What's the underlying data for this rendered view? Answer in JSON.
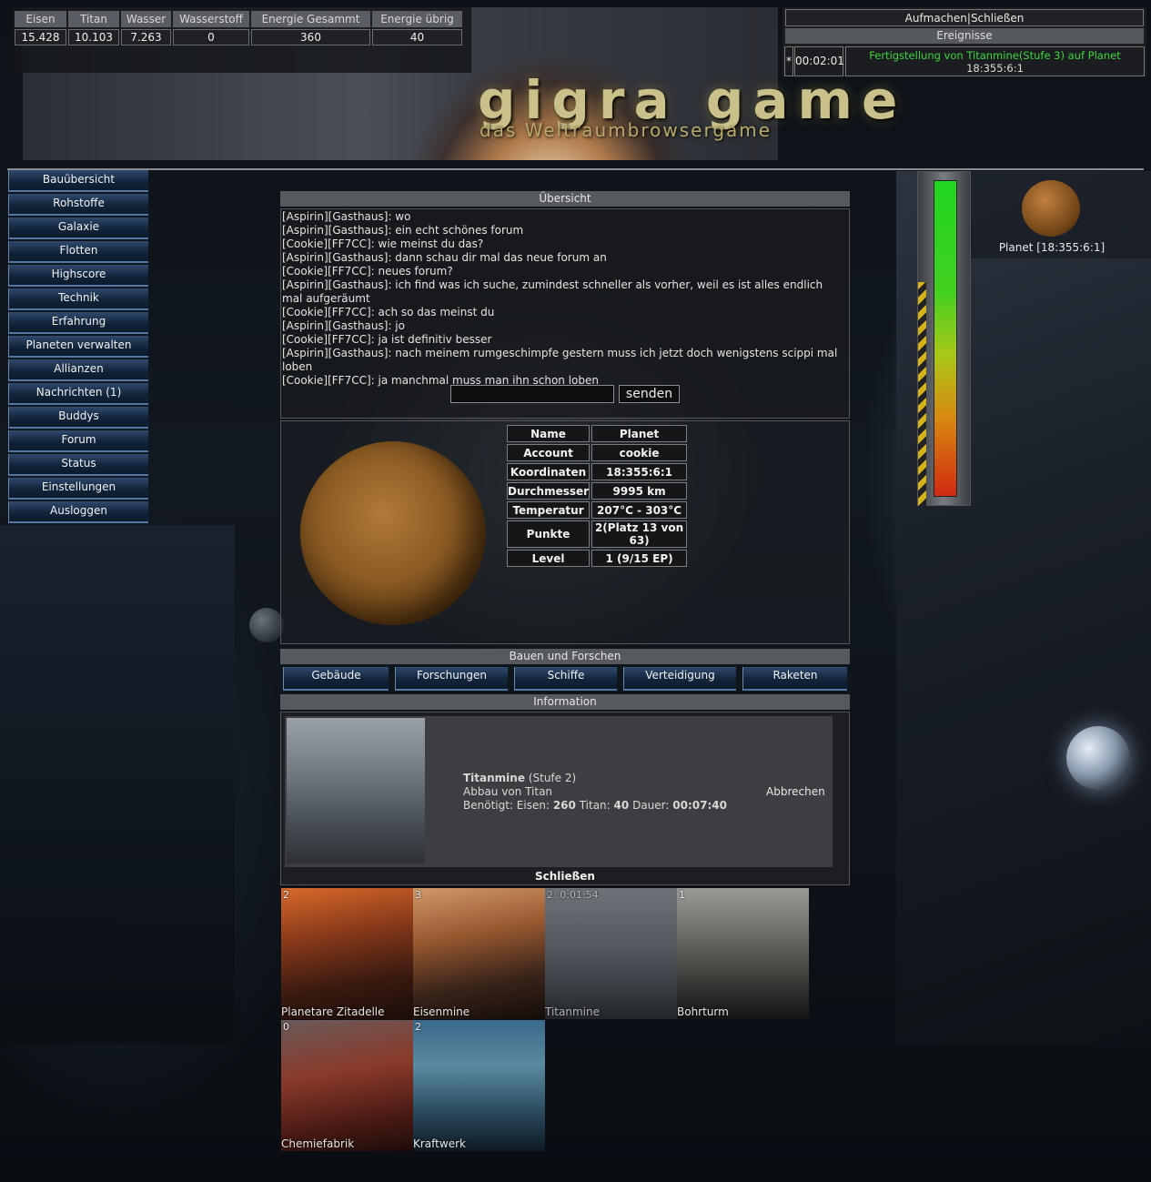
{
  "resources": {
    "headers": [
      "Eisen",
      "Titan",
      "Wasser",
      "Wasserstoff",
      "Energie Gesammt",
      "Energie übrig"
    ],
    "values": [
      "15.428",
      "10.103",
      "7.263",
      "0",
      "360",
      "40"
    ]
  },
  "header": {
    "logo_main": "gigra  game",
    "logo_sub": "das Weltraumbrowsergame"
  },
  "events": {
    "links": "Aufmachen|Schließen",
    "title": "Ereignisse",
    "marker": "*",
    "countdown": "00:02:01",
    "text_line1": "Fertigstellung von Titanmine(Stufe 3) auf Planet",
    "text_line2": "18:355:6:1"
  },
  "menu": [
    "Bauübersicht",
    "Rohstoffe",
    "Galaxie",
    "Flotten",
    "Highscore",
    "Technik",
    "Erfahrung",
    "Planeten verwalten",
    "Allianzen",
    "Nachrichten (1)",
    "Buddys",
    "Forum",
    "Status",
    "Einstellungen",
    "Ausloggen"
  ],
  "overview": {
    "title": "Übersicht",
    "chat": [
      "[Aspirin][Gasthaus]: wo",
      "[Aspirin][Gasthaus]: ein echt schönes forum",
      "[Cookie][FF7CC]: wie meinst du das?",
      "[Aspirin][Gasthaus]: dann schau dir mal das neue forum an",
      "[Cookie][FF7CC]: neues forum?",
      "[Aspirin][Gasthaus]: ich find was ich suche, zumindest schneller als vorher, weil es ist alles endlich mal aufgeräumt",
      "[Cookie][FF7CC]: ach so das meinst du",
      "[Aspirin][Gasthaus]: jo",
      "[Cookie][FF7CC]: ja ist definitiv besser",
      "[Aspirin][Gasthaus]: nach meinem rumgeschimpfe gestern muss ich jetzt doch wenigstens scippi mal loben",
      "[Cookie][FF7CC]: ja manchmal muss man ihn schon loben"
    ],
    "send_label": "senden"
  },
  "planet_info": [
    [
      "Name",
      "Planet"
    ],
    [
      "Account",
      "cookie"
    ],
    [
      "Koordinaten",
      "18:355:6:1"
    ],
    [
      "Durchmesser",
      "9995 km"
    ],
    [
      "Temperatur",
      "207°C - 303°C"
    ],
    [
      "Punkte",
      "2(Platz 13 von 63)"
    ],
    [
      "Level",
      "1 (9/15 EP)"
    ]
  ],
  "build": {
    "title": "Bauen und Forschen",
    "tabs": [
      "Gebäude",
      "Forschungen",
      "Schiffe",
      "Verteidigung",
      "Raketen"
    ]
  },
  "information": {
    "title": "Information",
    "name": "Titanmine",
    "stage": "(Stufe 2)",
    "desc": "Abbau von Titan",
    "cost_label": "Benötigt: Eisen:",
    "iron": "260",
    "titan_label": "Titan:",
    "titan": "40",
    "duration_label": "Dauer:",
    "duration": "00:07:40",
    "cancel": "Abbrechen",
    "close": "Schließen"
  },
  "buildings": [
    {
      "level": "2",
      "name": "Planetare Zitadelle"
    },
    {
      "level": "3",
      "name": "Eisenmine"
    },
    {
      "level": "2: 0:01:54",
      "name": "Titanmine"
    },
    {
      "level": "1",
      "name": "Bohrturm"
    },
    {
      "level": "0",
      "name": "Chemiefabrik"
    },
    {
      "level": "2",
      "name": "Kraftwerk"
    }
  ],
  "right_panel": {
    "planet_label": "Planet [18:355:6:1]"
  },
  "colors": {
    "event_green": "#3fd63f",
    "menu_blue": "#13253c",
    "panel_grey": "#56595e"
  }
}
